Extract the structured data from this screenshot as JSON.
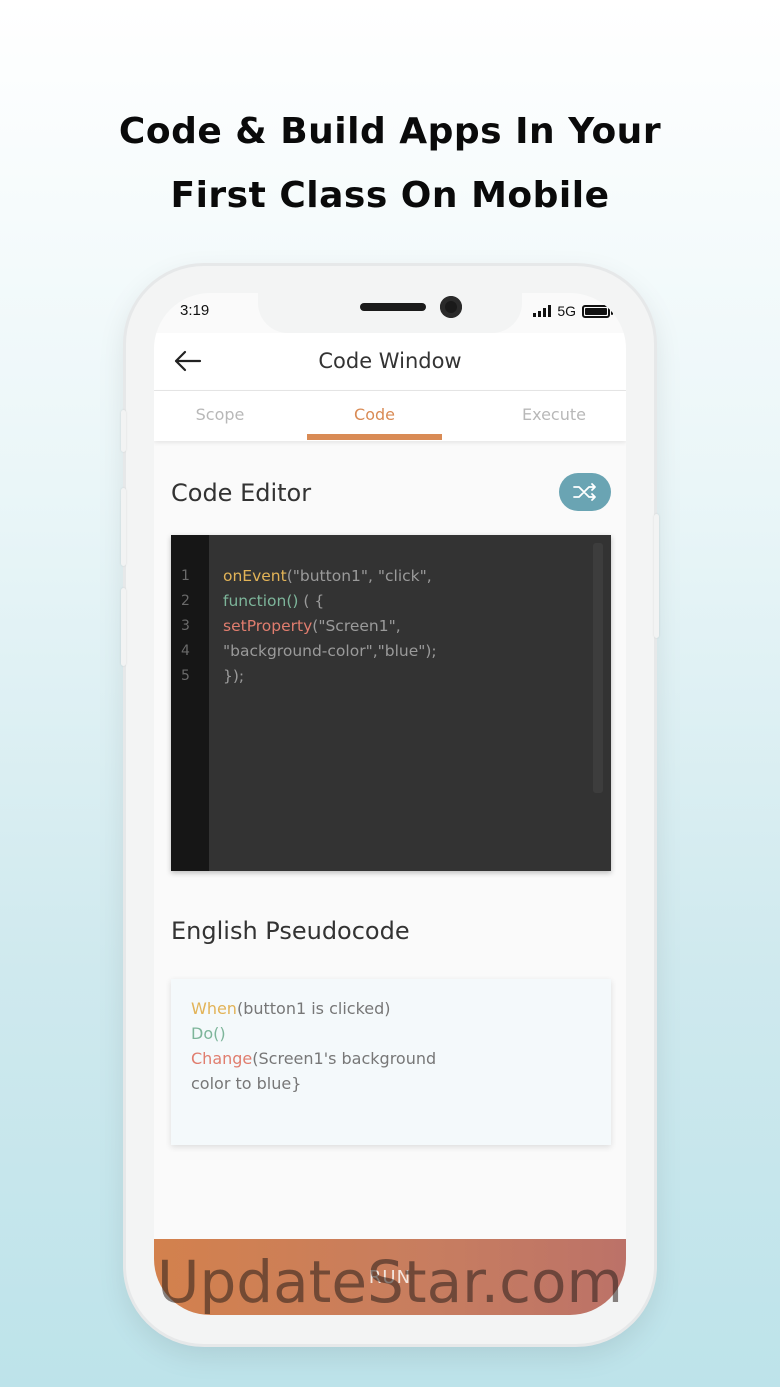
{
  "headline": {
    "line1": "Code & Build Apps In Your",
    "line2": "First Class On Mobile"
  },
  "status": {
    "time": "3:19",
    "network": "5G"
  },
  "appbar": {
    "title": "Code Window",
    "back_icon": "arrow-left-icon"
  },
  "tabs": [
    {
      "label": "Scope",
      "active": false
    },
    {
      "label": "Code",
      "active": true
    },
    {
      "label": "Execute",
      "active": false
    }
  ],
  "editor": {
    "title": "Code Editor",
    "shuffle_icon": "shuffle-icon",
    "line_numbers": [
      "1",
      "2",
      "3",
      "4",
      "5"
    ],
    "lines": [
      {
        "kw": "onEvent",
        "rest": "(\"button1\", \"click\","
      },
      {
        "kw": "function()",
        "rest": " ( {"
      },
      {
        "kw": "setProperty",
        "rest": "(\"Screen1\","
      },
      {
        "kw": "",
        "rest": "\"background-color\",\"blue\");"
      },
      {
        "kw": "",
        "rest": "});"
      }
    ]
  },
  "pseudocode": {
    "title": "English Pseudocode",
    "lines": [
      {
        "kw": "When",
        "rest": "(button1 is clicked)"
      },
      {
        "kw": "Do()",
        "rest": ""
      },
      {
        "kw": "Change",
        "rest": "(Screen1's background"
      },
      {
        "kw": "",
        "rest": "color to blue}"
      }
    ]
  },
  "run_button": {
    "label": "RUN"
  },
  "watermark": "UpdateStar.com",
  "colors": {
    "accent": "#d98b55",
    "shuffle": "#6aa4b3",
    "editor_bg": "#333333",
    "keyword_yellow": "#e2b357",
    "keyword_green": "#7db59a",
    "keyword_red": "#e07d6e"
  }
}
